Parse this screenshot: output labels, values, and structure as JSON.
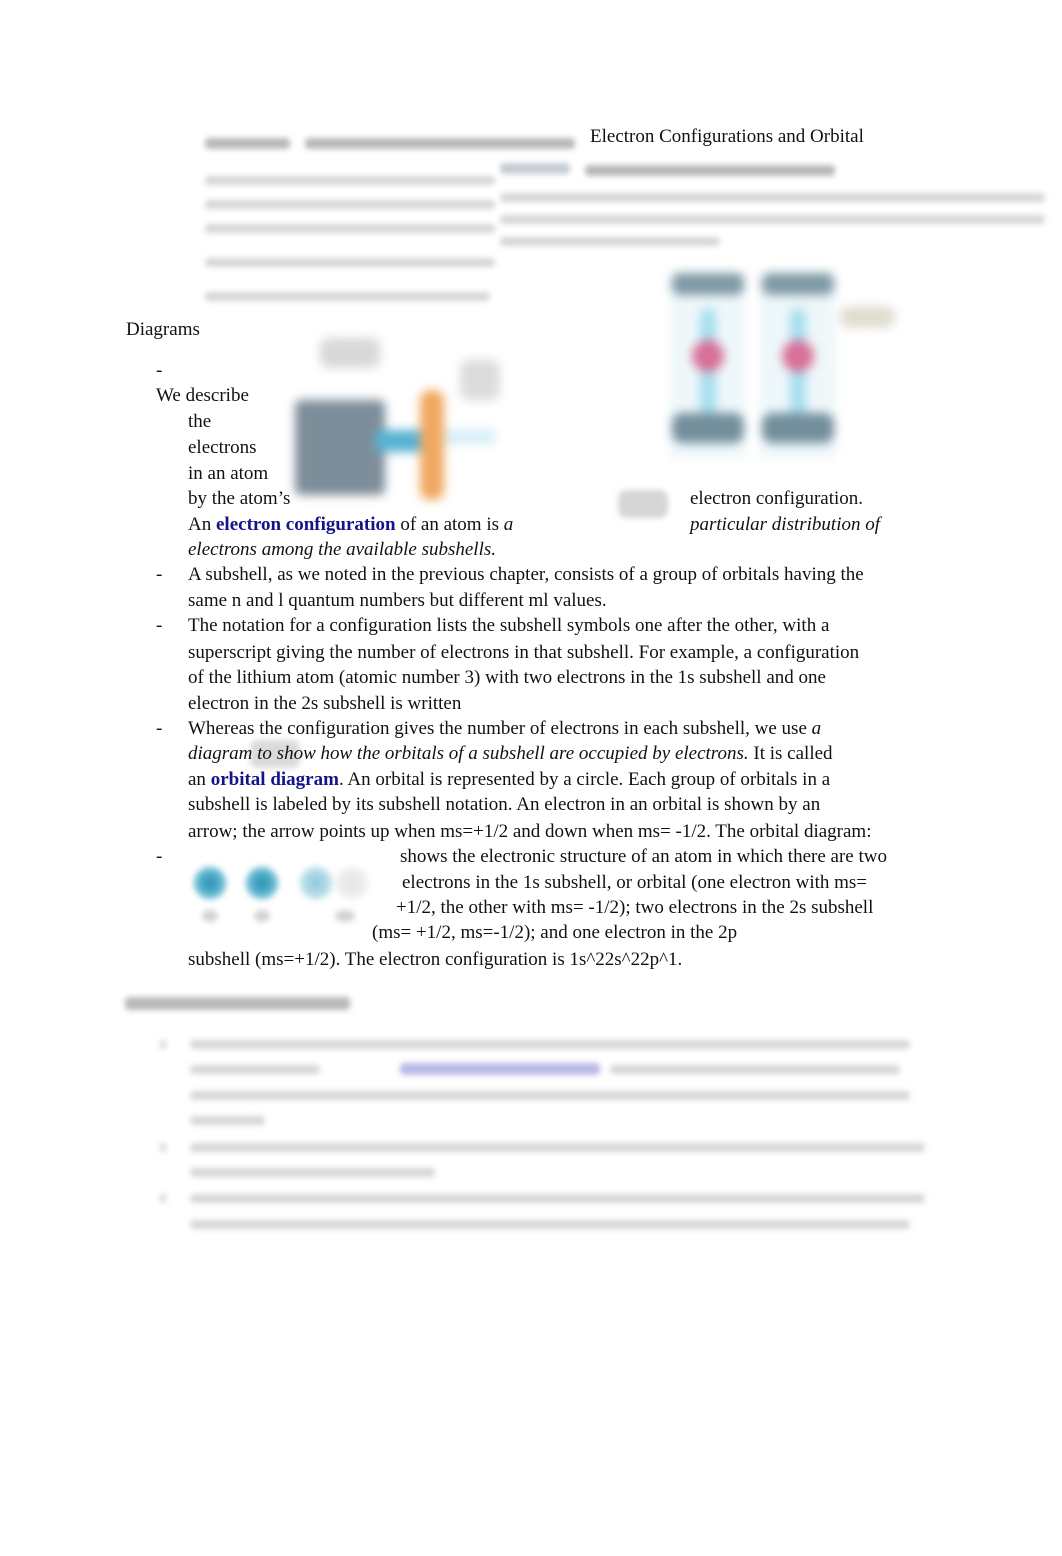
{
  "document": {
    "title_line1": "Electron Configurations and Orbital",
    "title_line2": "Diagrams",
    "bullet_marker": "-",
    "bullets": [
      {
        "lines": [
          "We describe",
          "the",
          "electrons",
          "in an atom",
          "by the atom’s"
        ],
        "line_end": "electron configuration.",
        "def_prefix": "An ",
        "def_term": "electron configuration",
        "def_mid": " of an atom is ",
        "def_italic_a": "a",
        "def_italic_right": "particular distribution of",
        "def_italic_last": "electrons among the available subshells."
      },
      {
        "lines": [
          " A subshell, as we noted in the previous chapter, consists of a group of orbitals having the",
          "same n and l quantum numbers but different ml values."
        ]
      },
      {
        "lines": [
          "The notation for a configuration lists the subshell symbols one after the other, with a",
          "superscript giving the number of electrons in that subshell. For example, a configuration",
          "of the lithium atom (atomic number 3) with two electrons in the 1s subshell and one",
          "electron in the 2s subshell is written"
        ]
      },
      {
        "l1_plain": "Whereas the configuration gives the number of electrons in each subshell, we use ",
        "l1_italic": "a",
        "l2_italic": "diagram to show how the orbitals of a subshell are occupied by electrons.",
        "l2_plain": " It is called",
        "l3_prefix": "an ",
        "l3_term": "orbital diagram",
        "l3_rest": ". An orbital is represented by a circle. Each group of orbitals in a",
        "l4": "subshell is labeled by its subshell notation. An electron in an orbital is shown by an",
        "l5": "arrow; the arrow points up when ms=+1/2 and down when ms= -1/2. The orbital diagram:"
      },
      {
        "lines": [
          "shows the electronic structure of an atom in which there are two",
          "electrons in the 1s subshell, or orbital (one electron with ms=",
          "+1/2, the other with ms= -1/2); two electrons in the 2s subshell",
          "(ms= +1/2, ms=-1/2); and one electron in the 2p",
          "subshell (ms=+1/2). The electron configuration is 1s^22s^22p^1."
        ]
      }
    ],
    "colors": {
      "term_link": "#141488",
      "orbital_filled": "#2b8fb0",
      "illustration_orange": "#f0a860",
      "illustration_nucleus": "#d87098"
    }
  }
}
